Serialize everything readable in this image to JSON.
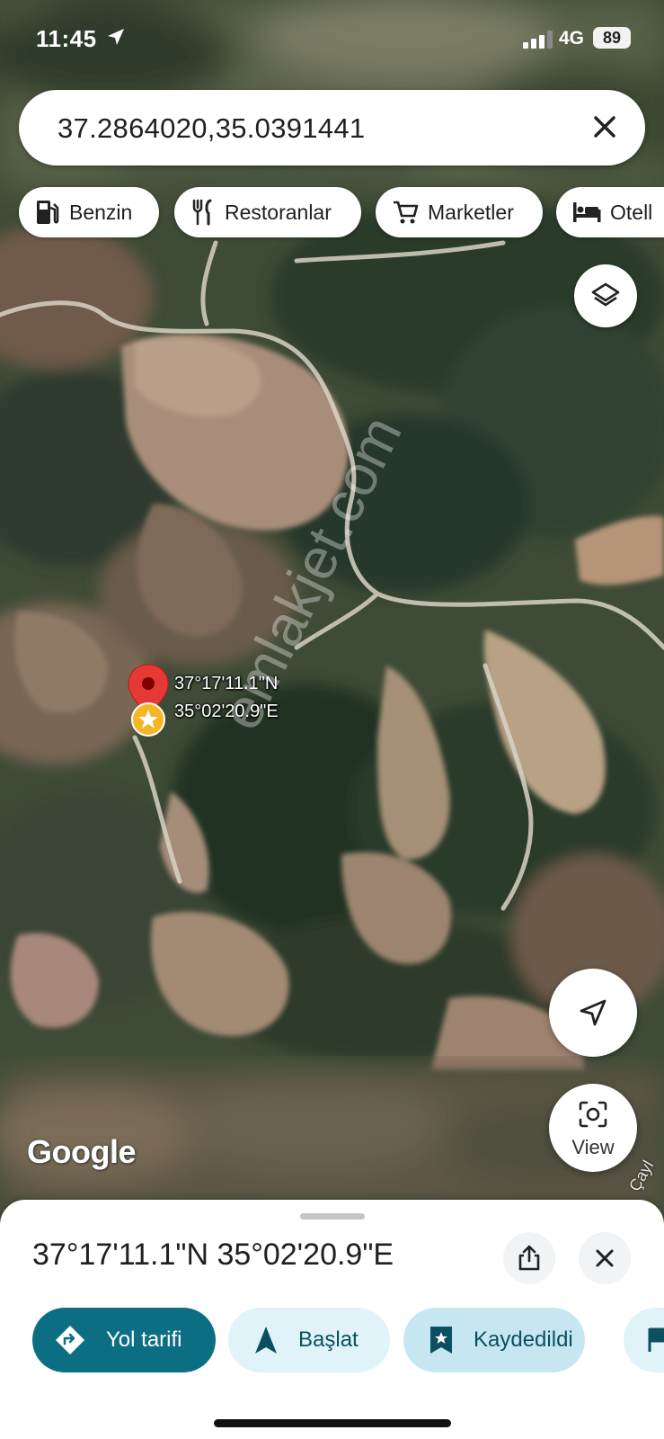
{
  "status_bar": {
    "time": "11:45",
    "network": "4G",
    "battery": "89"
  },
  "search": {
    "query": "37.2864020,35.0391441"
  },
  "chips": [
    {
      "label": "Benzin",
      "icon": "gas-station-icon"
    },
    {
      "label": "Restoranlar",
      "icon": "restaurant-icon"
    },
    {
      "label": "Marketler",
      "icon": "shopping-cart-icon"
    },
    {
      "label": "Otell",
      "icon": "hotel-bed-icon"
    }
  ],
  "map": {
    "pin_lat": "37°17'11.1\"N",
    "pin_lng": "35°02'20.9\"E",
    "watermark": "emlakjet.com",
    "logo": "Google",
    "place_label": "Çayl"
  },
  "view_button": {
    "label": "View"
  },
  "sheet": {
    "title": "37°17'11.1\"N 35°02'20.9\"E",
    "actions": [
      {
        "label": "Yol tarifi",
        "icon": "directions-icon"
      },
      {
        "label": "Başlat",
        "icon": "navigation-arrow-icon"
      },
      {
        "label": "Kaydedildi",
        "icon": "bookmark-star-icon"
      }
    ]
  },
  "colors": {
    "accent": "#0b6e82",
    "chip_light": "#dff3f9",
    "saved_bg": "#c6e7f2",
    "pin_red": "#e53935",
    "pin_gold": "#f5b623"
  }
}
